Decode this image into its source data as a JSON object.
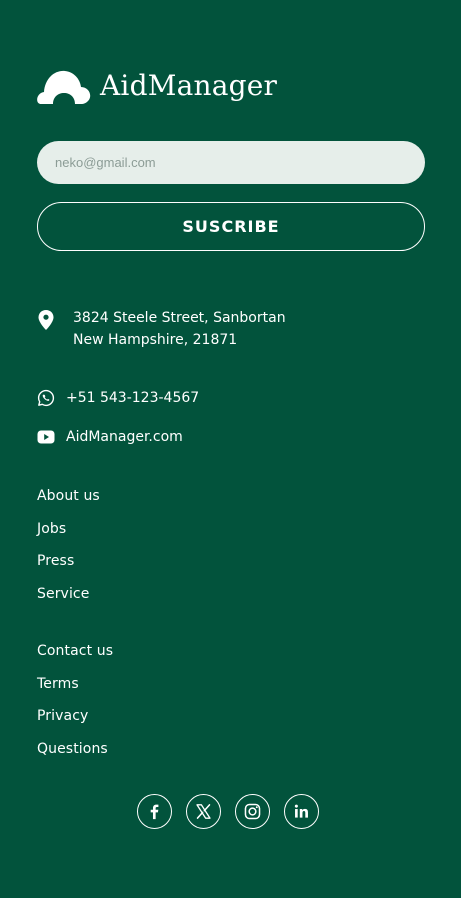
{
  "brand": {
    "name": "AidManager",
    "logo_icon": "cloud-logo-icon"
  },
  "subscribe": {
    "email_placeholder": "neko@gmail.com",
    "email_value": "",
    "button_label": "SUSCRIBE"
  },
  "contact": {
    "address_line1": "3824 Steele Street, Sanbortan",
    "address_line2": "New Hampshire, 21871",
    "address_icon": "location-pin-icon",
    "phone": "+51 543-123-4567",
    "phone_icon": "whatsapp-icon",
    "website": "AidManager.com",
    "website_icon": "youtube-icon"
  },
  "nav_primary": [
    "About us",
    "Jobs",
    "Press",
    "Service"
  ],
  "nav_secondary": [
    "Contact us",
    "Terms",
    "Privacy",
    "Questions"
  ],
  "social": [
    {
      "name": "facebook",
      "icon": "facebook-icon"
    },
    {
      "name": "x",
      "icon": "x-icon"
    },
    {
      "name": "instagram",
      "icon": "instagram-icon"
    },
    {
      "name": "linkedin",
      "icon": "linkedin-icon"
    }
  ],
  "colors": {
    "background": "#02533c",
    "input_background": "#e6eeea",
    "text": "#ffffff"
  }
}
